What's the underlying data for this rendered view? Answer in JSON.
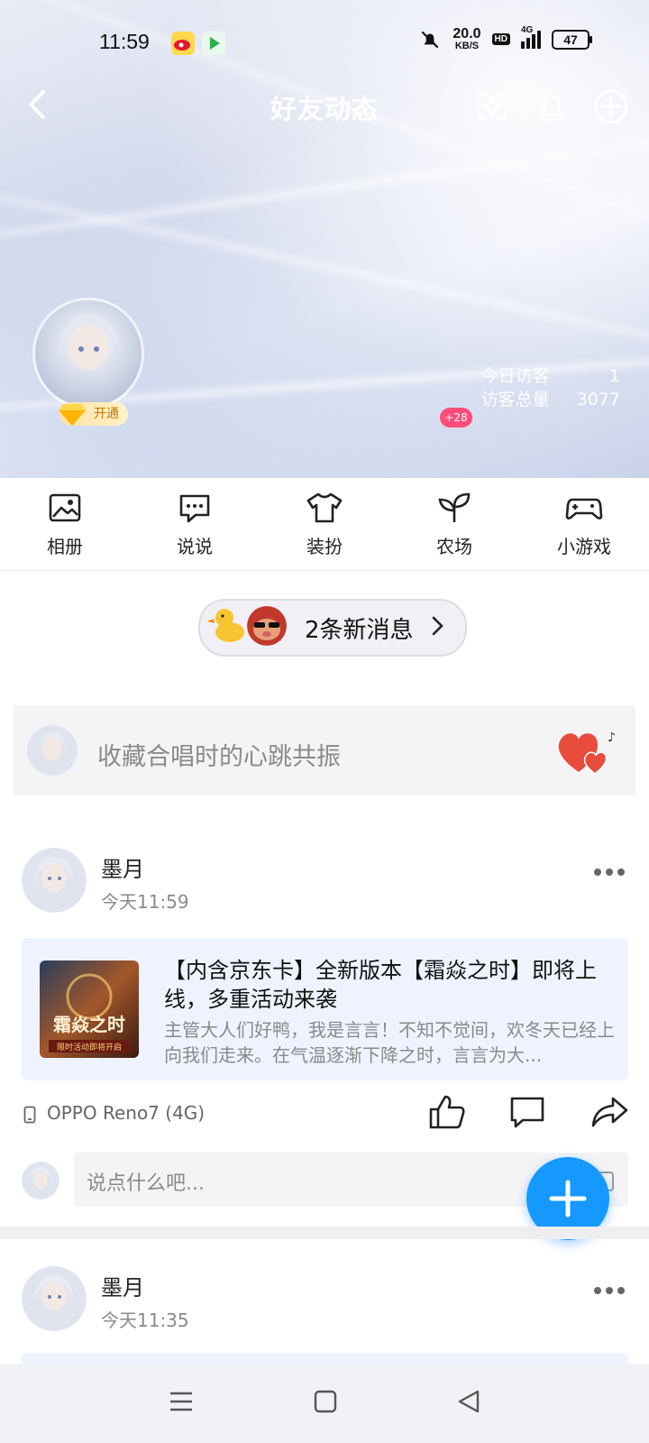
{
  "status_bar": {
    "time": "11:59",
    "net_speed_value": "20.0",
    "net_speed_unit": "KB/S",
    "hd_label": "HD",
    "network_label": "4G",
    "battery": "47"
  },
  "header": {
    "title": "好友动态",
    "vip_label": "开通",
    "badge_count": "+28",
    "visitors_today_label": "今日访客",
    "visitors_today_value": "1",
    "visitors_total_label": "访客总量",
    "visitors_total_value": "3077"
  },
  "nav": {
    "items": [
      {
        "label": "相册",
        "icon": "photo-album-icon"
      },
      {
        "label": "说说",
        "icon": "chat-bubble-icon"
      },
      {
        "label": "装扮",
        "icon": "tshirt-icon"
      },
      {
        "label": "农场",
        "icon": "sprout-icon"
      },
      {
        "label": "小游戏",
        "icon": "gamepad-icon"
      }
    ]
  },
  "new_messages": {
    "label": "2条新消息"
  },
  "post_prompt": {
    "placeholder": "收藏合唱时的心跳共振"
  },
  "feed": [
    {
      "author": "墨月",
      "time": "今天11:59",
      "card_title": "【内含京东卡】全新版本【霜焱之时】即将上线，多重活动来袭",
      "card_desc": "主管大人们好鸭，我是言言！不知不觉间，欢冬天已经上向我们走来。在气温逐渐下降之时，言言为大...",
      "card_image_title": "霜焱之时",
      "card_image_subtitle": "限时活动即将开启",
      "device": "OPPO Reno7 (4G)",
      "comment_placeholder": "说点什么吧..."
    },
    {
      "author": "墨月",
      "time": "今天11:35"
    }
  ],
  "colors": {
    "accent": "#1599ff",
    "badge": "#ff4d7a",
    "vip_text": "#c47700"
  }
}
